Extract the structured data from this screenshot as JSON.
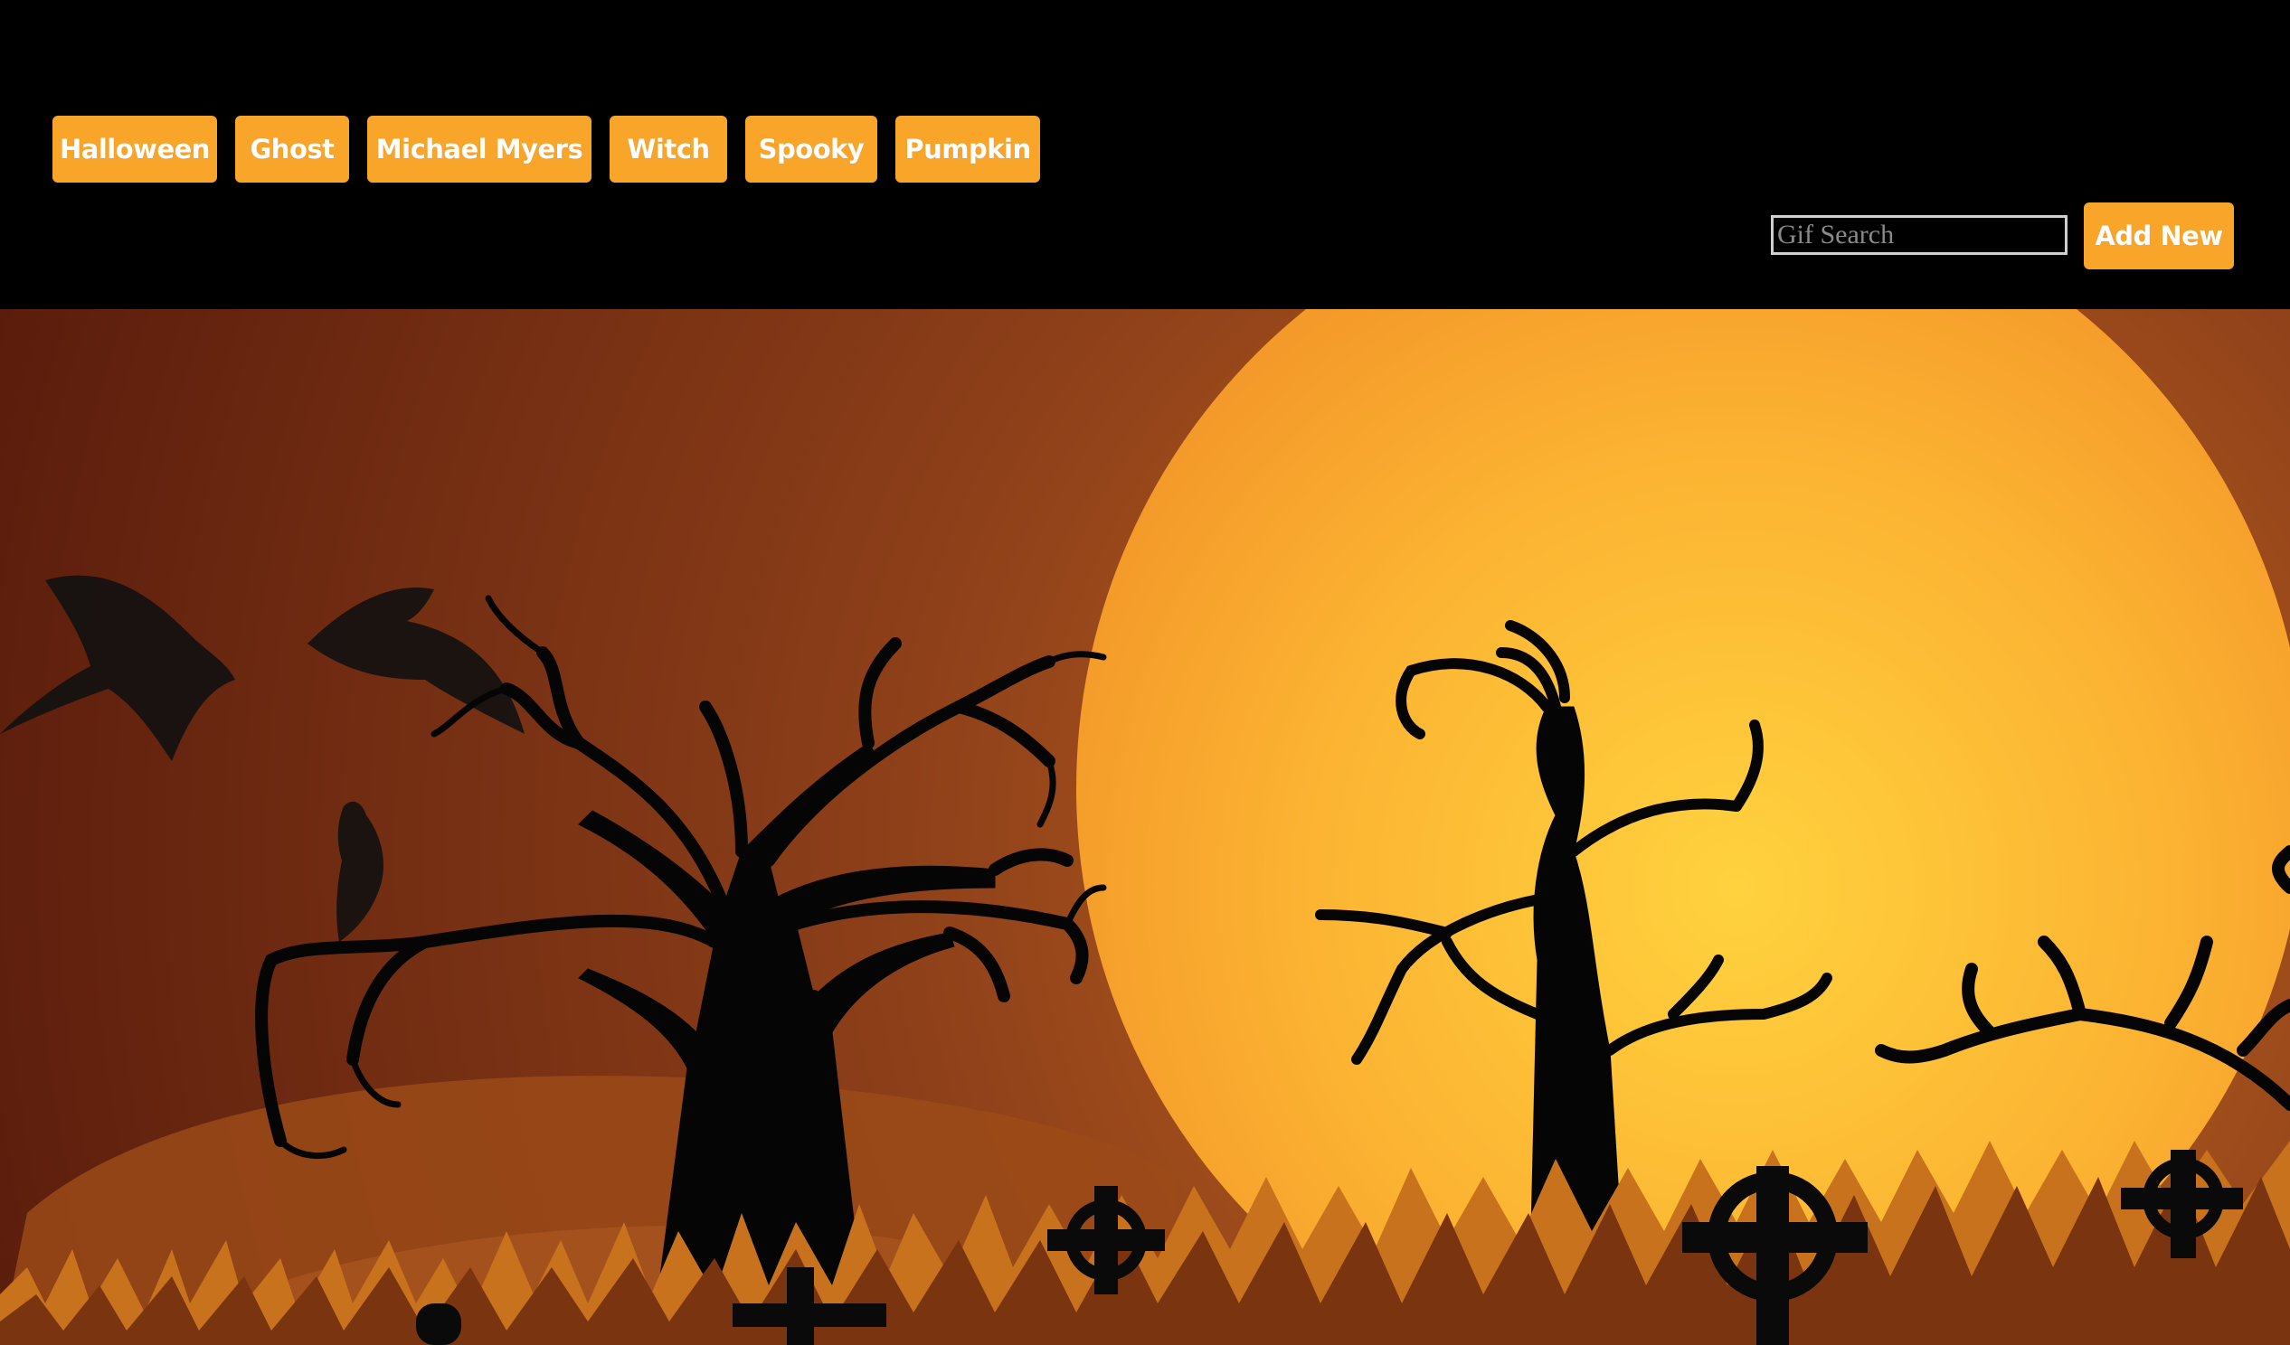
{
  "categories": [
    "Halloween",
    "Ghost",
    "Michael Myers",
    "Witch",
    "Spooky",
    "Pumpkin"
  ],
  "search": {
    "placeholder": "Gif Search"
  },
  "add_button": {
    "label": "Add New"
  },
  "colors": {
    "accent": "#f8a52a",
    "background": "#000000",
    "moon": "#fcc53a",
    "sky": "#8a3a16"
  },
  "gif_scene": {
    "description_icons": [
      "bat-icon",
      "dead-tree-icon",
      "moon-icon",
      "tombstone-cross-icon",
      "grass-icon"
    ]
  }
}
